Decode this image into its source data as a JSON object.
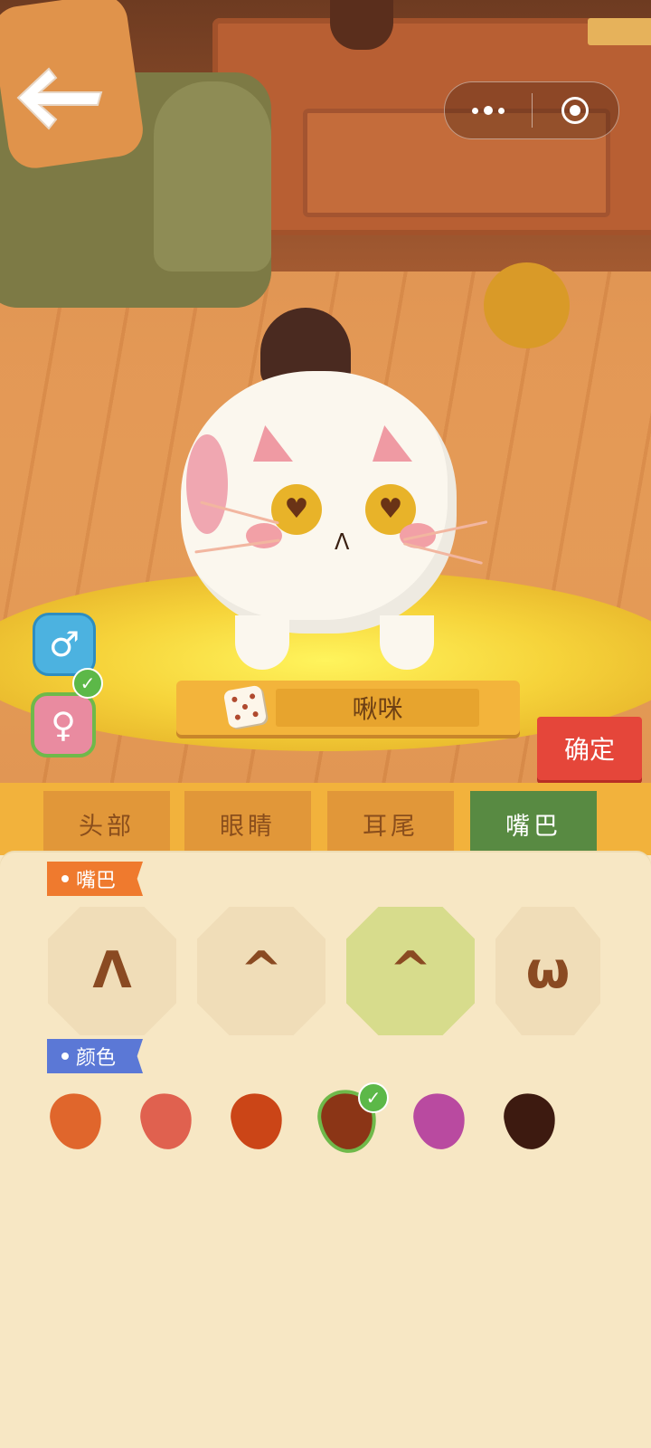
{
  "topbar": {
    "back_label": "Back",
    "more_label": "More",
    "close_label": "Close"
  },
  "pet": {
    "name": "啾咪",
    "gender_options": [
      {
        "symbol": "♂",
        "label": "male",
        "selected": false,
        "color": "#4cb2e0"
      },
      {
        "symbol": "♀",
        "label": "female",
        "selected": true,
        "color": "#e98ba0"
      }
    ]
  },
  "actions": {
    "confirm_label": "确定",
    "randomize_label": "dice"
  },
  "tabs": [
    {
      "label": "头部",
      "active": false
    },
    {
      "label": "眼睛",
      "active": false
    },
    {
      "label": "耳尾",
      "active": false
    },
    {
      "label": "嘴巴",
      "active": true
    }
  ],
  "sections": {
    "shape_title": "嘴巴",
    "color_title": "颜色"
  },
  "mouth_options": [
    {
      "glyph": "ᐱ",
      "selected": false
    },
    {
      "glyph": "^",
      "selected": false
    },
    {
      "glyph": "^",
      "selected": true
    },
    {
      "glyph": "ω",
      "selected": false
    }
  ],
  "color_options": [
    {
      "hex": "#e0662c",
      "selected": false
    },
    {
      "hex": "#e0614f",
      "selected": false
    },
    {
      "hex": "#cb4517",
      "selected": false
    },
    {
      "hex": "#8b3516",
      "selected": true
    },
    {
      "hex": "#b94aa0",
      "selected": false
    },
    {
      "hex": "#3d1a10",
      "selected": false
    }
  ],
  "colors": {
    "active_tab": "#588a42",
    "tab": "#e19739",
    "confirm": "#e5463a",
    "check": "#5cb848"
  }
}
